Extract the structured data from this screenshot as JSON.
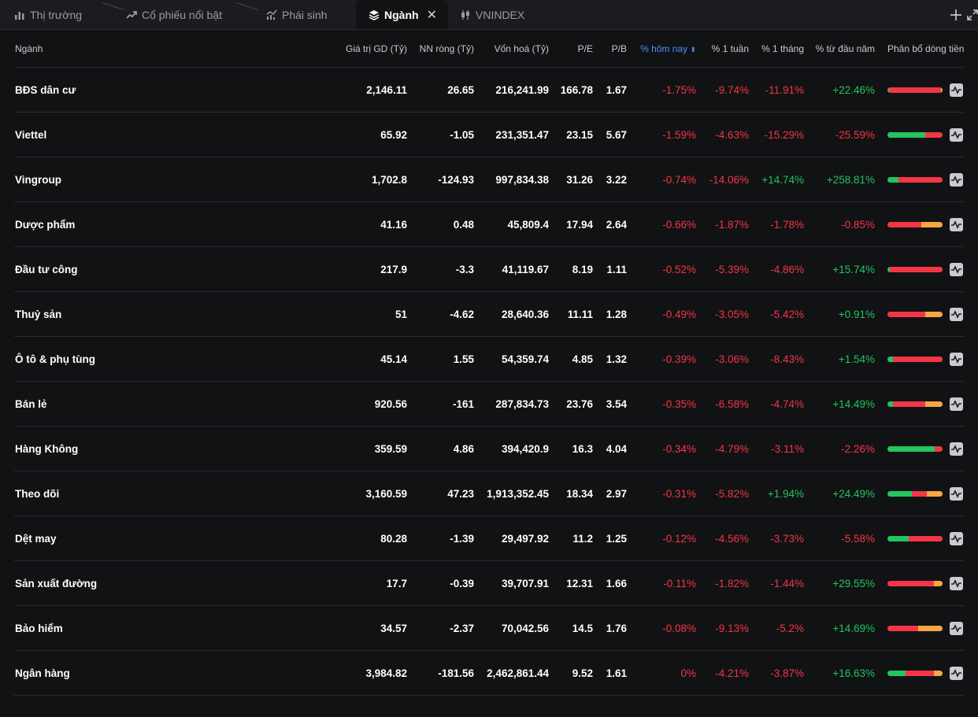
{
  "tabs": [
    {
      "label": "Thị trường",
      "icon": "bar-chart-icon"
    },
    {
      "label": "Cổ phiếu nổi bật",
      "icon": "trending-up-icon"
    },
    {
      "label": "Phái sinh",
      "icon": "derivative-chart-icon"
    },
    {
      "label": "Ngành",
      "icon": "layers-icon",
      "active": true
    },
    {
      "label": "VNINDEX",
      "icon": "candlestick-icon"
    }
  ],
  "colors": {
    "positive": "#22c55e",
    "negative": "#f23645",
    "neutral": "#f5a742",
    "sort_accent": "#4d8dff"
  },
  "columns": {
    "sector": "Ngành",
    "value": "Giá trị GD (Tỷ)",
    "foreign_net": "NN ròng (Tỷ)",
    "market_cap": "Vốn hoá (Tỷ)",
    "pe": "P/E",
    "pb": "P/B",
    "today": "% hôm nay",
    "week": "% 1 tuần",
    "month": "% 1 tháng",
    "ytd": "% từ đầu năm",
    "flow": "Phân bổ dòng tiền"
  },
  "rows": [
    {
      "sector": "BĐS dân cư",
      "value": "2,146.11",
      "foreign_net": "26.65",
      "market_cap": "216,241.99",
      "pe": "166.78",
      "pb": "1.67",
      "today": "-1.75%",
      "week": "-9.74%",
      "month": "-11.91%",
      "ytd": "+22.46%",
      "flow": [
        0.03,
        0.94,
        0.03
      ]
    },
    {
      "sector": "Viettel",
      "value": "65.92",
      "foreign_net": "-1.05",
      "market_cap": "231,351.47",
      "pe": "23.15",
      "pb": "5.67",
      "today": "-1.59%",
      "week": "-4.63%",
      "month": "-15.29%",
      "ytd": "-25.59%",
      "flow": [
        0.68,
        0.32,
        0.0
      ]
    },
    {
      "sector": "Vingroup",
      "value": "1,702.8",
      "foreign_net": "-124.93",
      "market_cap": "997,834.38",
      "pe": "31.26",
      "pb": "3.22",
      "today": "-0.74%",
      "week": "-14.06%",
      "month": "+14.74%",
      "ytd": "+258.81%",
      "flow": [
        0.2,
        0.8,
        0.0
      ]
    },
    {
      "sector": "Dược phẩm",
      "value": "41.16",
      "foreign_net": "0.48",
      "market_cap": "45,809.4",
      "pe": "17.94",
      "pb": "2.64",
      "today": "-0.66%",
      "week": "-1.87%",
      "month": "-1.78%",
      "ytd": "-0.85%",
      "flow": [
        0.0,
        0.62,
        0.38
      ]
    },
    {
      "sector": "Đầu tư công",
      "value": "217.9",
      "foreign_net": "-3.3",
      "market_cap": "41,119.67",
      "pe": "8.19",
      "pb": "1.11",
      "today": "-0.52%",
      "week": "-5.39%",
      "month": "-4.86%",
      "ytd": "+15.74%",
      "flow": [
        0.04,
        0.96,
        0.0
      ]
    },
    {
      "sector": "Thuỷ sản",
      "value": "51",
      "foreign_net": "-4.62",
      "market_cap": "28,640.36",
      "pe": "11.11",
      "pb": "1.28",
      "today": "-0.49%",
      "week": "-3.05%",
      "month": "-5.42%",
      "ytd": "+0.91%",
      "flow": [
        0.0,
        0.68,
        0.32
      ]
    },
    {
      "sector": "Ô tô & phụ tùng",
      "value": "45.14",
      "foreign_net": "1.55",
      "market_cap": "54,359.74",
      "pe": "4.85",
      "pb": "1.32",
      "today": "-0.39%",
      "week": "-3.06%",
      "month": "-8.43%",
      "ytd": "+1.54%",
      "flow": [
        0.1,
        0.9,
        0.0
      ]
    },
    {
      "sector": "Bán lẻ",
      "value": "920.56",
      "foreign_net": "-161",
      "market_cap": "287,834.73",
      "pe": "23.76",
      "pb": "3.54",
      "today": "-0.35%",
      "week": "-6.58%",
      "month": "-4.74%",
      "ytd": "+14.49%",
      "flow": [
        0.1,
        0.58,
        0.32
      ]
    },
    {
      "sector": "Hàng Không",
      "value": "359.59",
      "foreign_net": "4.86",
      "market_cap": "394,420.9",
      "pe": "16.3",
      "pb": "4.04",
      "today": "-0.34%",
      "week": "-4.79%",
      "month": "-3.11%",
      "ytd": "-2.26%",
      "flow": [
        0.86,
        0.14,
        0.0
      ]
    },
    {
      "sector": "Theo dõi",
      "value": "3,160.59",
      "foreign_net": "47.23",
      "market_cap": "1,913,352.45",
      "pe": "18.34",
      "pb": "2.97",
      "today": "-0.31%",
      "week": "-5.82%",
      "month": "+1.94%",
      "ytd": "+24.49%",
      "flow": [
        0.44,
        0.28,
        0.28
      ]
    },
    {
      "sector": "Dệt may",
      "value": "80.28",
      "foreign_net": "-1.39",
      "market_cap": "29,497.92",
      "pe": "11.2",
      "pb": "1.25",
      "today": "-0.12%",
      "week": "-4.56%",
      "month": "-3.73%",
      "ytd": "-5.58%",
      "flow": [
        0.38,
        0.62,
        0.0
      ]
    },
    {
      "sector": "Sản xuất đường",
      "value": "17.7",
      "foreign_net": "-0.39",
      "market_cap": "39,707.91",
      "pe": "12.31",
      "pb": "1.66",
      "today": "-0.11%",
      "week": "-1.82%",
      "month": "-1.44%",
      "ytd": "+29.55%",
      "flow": [
        0.0,
        0.84,
        0.16
      ]
    },
    {
      "sector": "Bảo hiểm",
      "value": "34.57",
      "foreign_net": "-2.37",
      "market_cap": "70,042.56",
      "pe": "14.5",
      "pb": "1.76",
      "today": "-0.08%",
      "week": "-9.13%",
      "month": "-5.2%",
      "ytd": "+14.69%",
      "flow": [
        0.0,
        0.55,
        0.45
      ]
    },
    {
      "sector": "Ngân hàng",
      "value": "3,984.82",
      "foreign_net": "-181.56",
      "market_cap": "2,462,861.44",
      "pe": "9.52",
      "pb": "1.61",
      "today": "0%",
      "week": "-4.21%",
      "month": "-3.87%",
      "ytd": "+16.63%",
      "flow": [
        0.33,
        0.52,
        0.15
      ]
    }
  ]
}
